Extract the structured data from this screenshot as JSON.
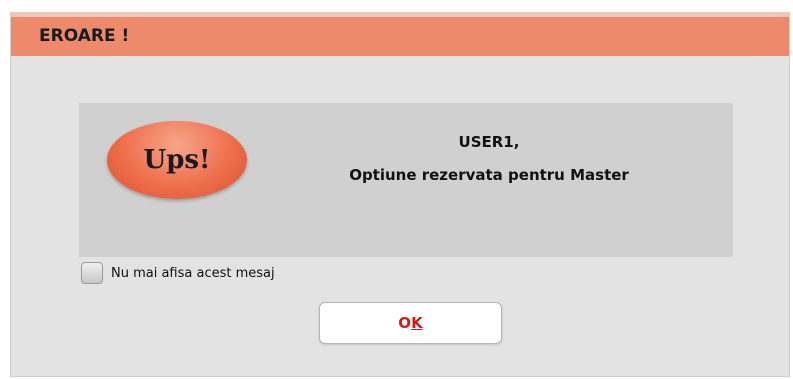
{
  "dialog": {
    "title": "EROARE !",
    "badge_text": "Ups!",
    "message_line1": "USER1,",
    "message_line2": "Optiune rezervata pentru Master",
    "checkbox_label": "Nu mai afisa acest mesaj",
    "checkbox_checked": false,
    "ok_label_first": "O",
    "ok_label_rest": "K"
  },
  "colors": {
    "titlebar": "#ee8a6c",
    "badge": "#ee6f4c",
    "ok_text": "#d11a1a",
    "panel": "#d0d0d0",
    "background": "#e3e3e3"
  },
  "icons": {
    "badge": "ups-badge-icon"
  }
}
